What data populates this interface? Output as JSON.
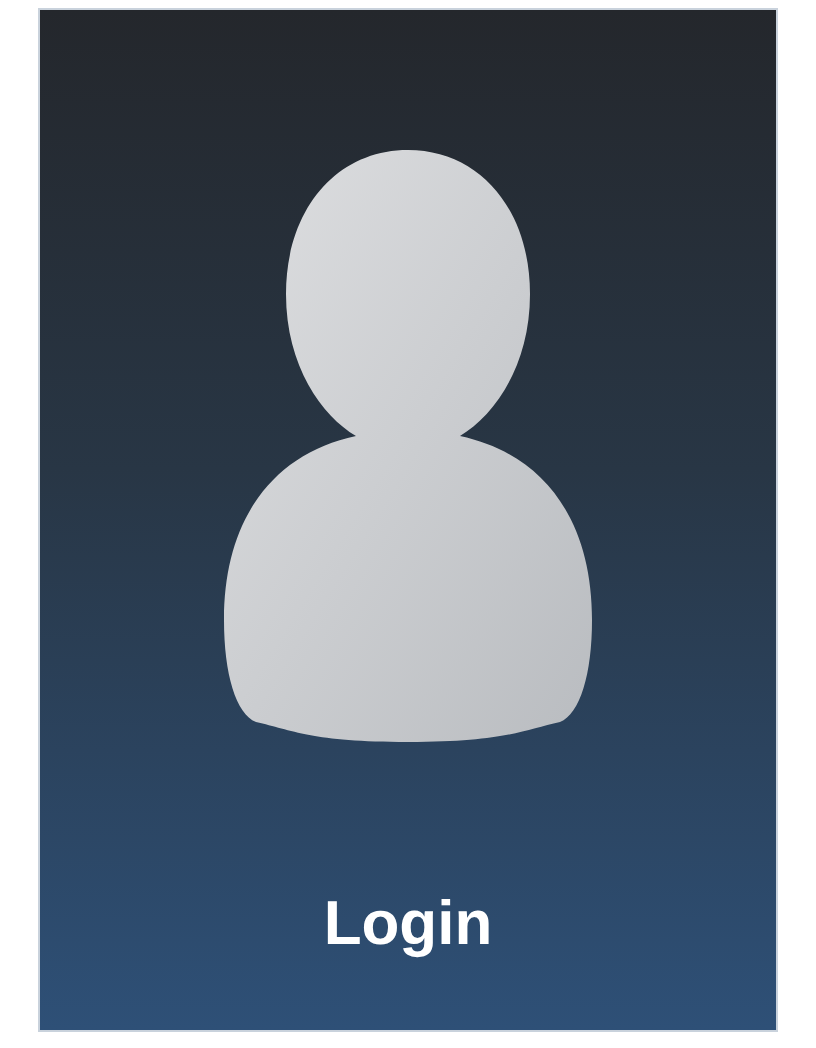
{
  "tile": {
    "label": "Login"
  }
}
